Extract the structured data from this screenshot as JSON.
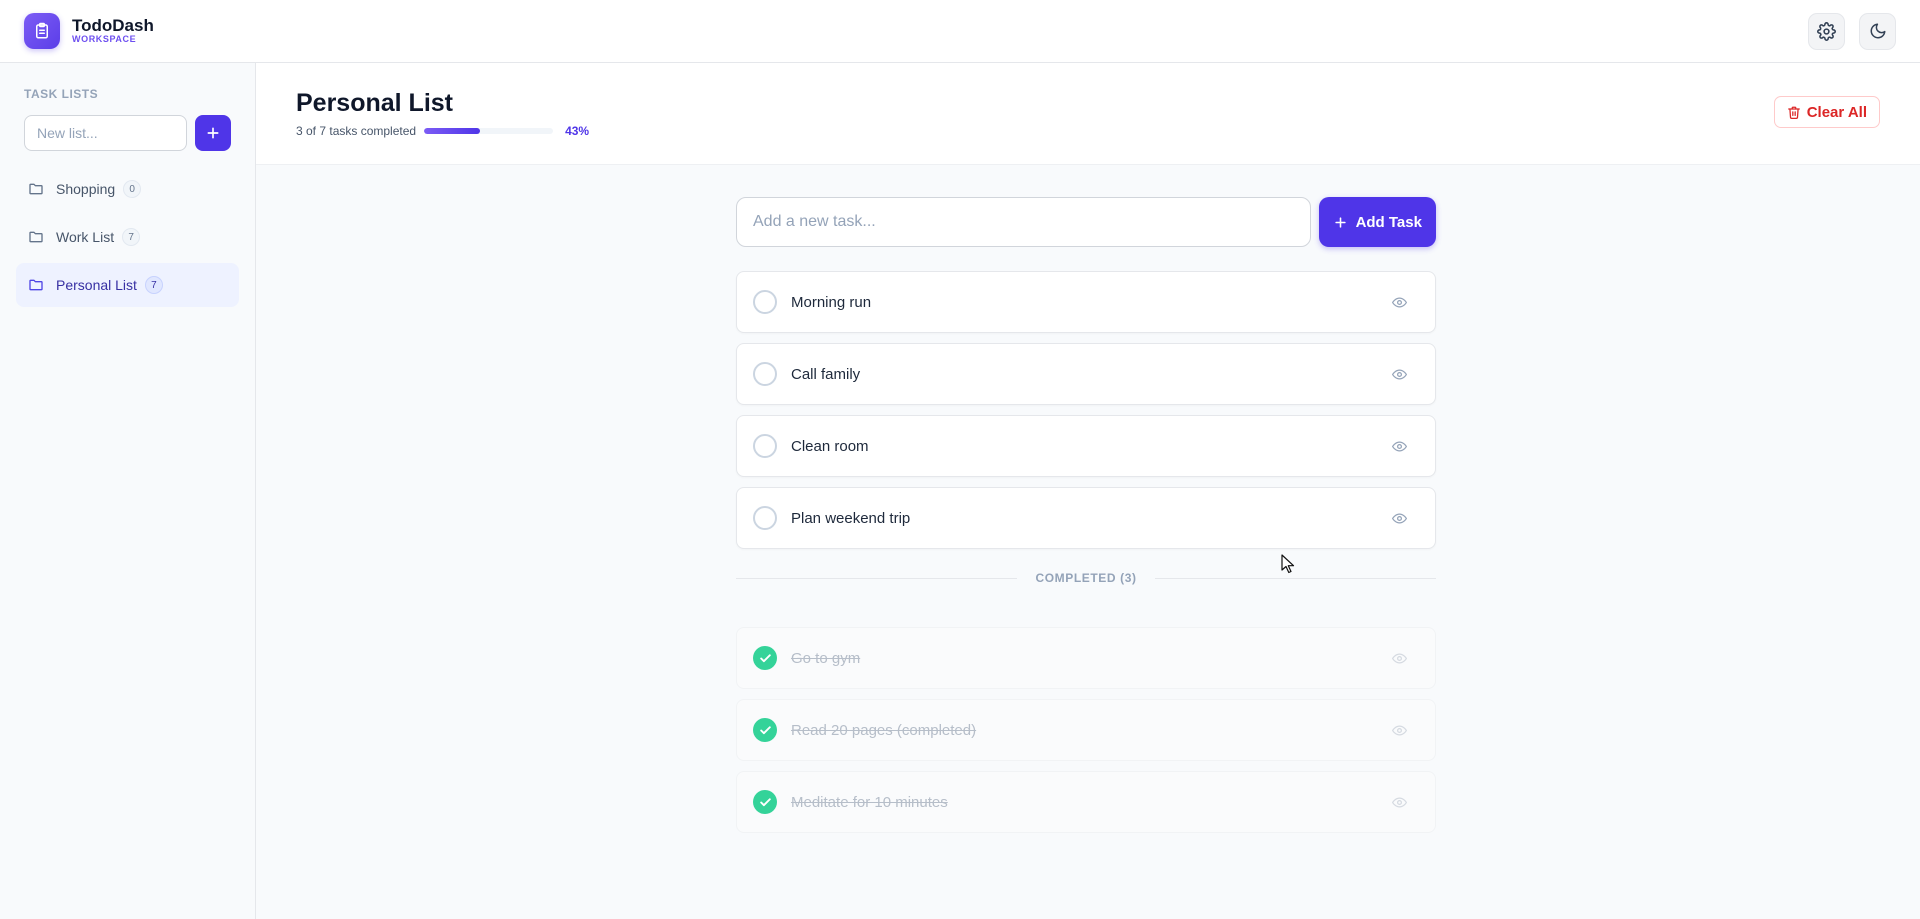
{
  "app": {
    "name": "TodoDash",
    "subtitle": "WORKSPACE"
  },
  "sidebar": {
    "heading": "TASK LISTS",
    "new_list_placeholder": "New list...",
    "lists": [
      {
        "label": "Shopping",
        "count": "0"
      },
      {
        "label": "Work List",
        "count": "7"
      },
      {
        "label": "Personal List",
        "count": "7"
      }
    ]
  },
  "header": {
    "title": "Personal List",
    "progress_text": "3 of 7 tasks completed",
    "progress_fraction": 0.43,
    "progress_percent": "43%",
    "clear_label": "Clear All"
  },
  "composer": {
    "placeholder": "Add a new task...",
    "button_label": "Add Task"
  },
  "tasks_open": [
    {
      "title": "Morning run"
    },
    {
      "title": "Call family"
    },
    {
      "title": "Clean room"
    },
    {
      "title": "Plan weekend trip"
    }
  ],
  "completed_label": "COMPLETED (3)",
  "tasks_done": [
    {
      "title": "Go to gym"
    },
    {
      "title": "Read 20 pages (completed)"
    },
    {
      "title": "Meditate for 10 minutes"
    }
  ],
  "colors": {
    "accent": "#4f35e8",
    "danger": "#dc2626",
    "success": "#34d399"
  }
}
